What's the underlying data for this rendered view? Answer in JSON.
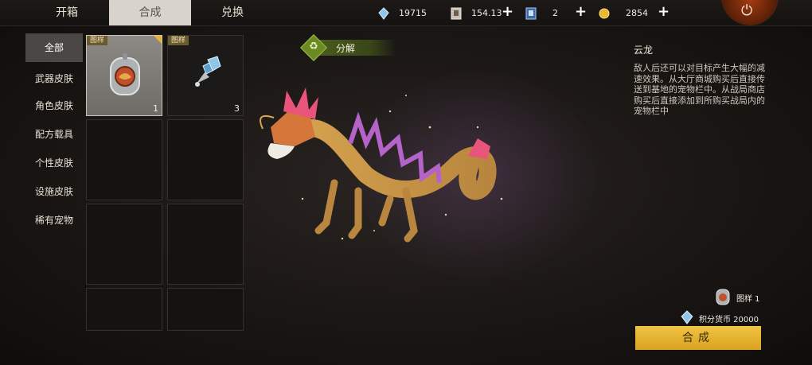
{
  "tabs": [
    {
      "label": "开箱"
    },
    {
      "label": "合成"
    },
    {
      "label": "兑换"
    }
  ],
  "resources": [
    {
      "icon": "crystal-currency-icon",
      "value": "19715"
    },
    {
      "icon": "ticket-card-icon",
      "value": "154.13"
    },
    {
      "icon": "blue-card-icon",
      "value": "2"
    },
    {
      "icon": "gold-coin-icon",
      "value": "2854"
    }
  ],
  "sidebar": {
    "items": [
      {
        "label": "全部"
      },
      {
        "label": "武器皮肤"
      },
      {
        "label": "角色皮肤"
      },
      {
        "label": "配方载具"
      },
      {
        "label": "个性皮肤"
      },
      {
        "label": "设施皮肤"
      },
      {
        "label": "稀有宠物"
      }
    ]
  },
  "inventory": [
    {
      "tag": "图样",
      "count": "1",
      "icon": "pet-badge-icon",
      "selected": true
    },
    {
      "tag": "图样",
      "count": "3",
      "icon": "crystal-rocket-icon",
      "selected": false
    }
  ],
  "decompose": {
    "label": "分解",
    "icon": "recycle-icon"
  },
  "detail": {
    "name": "云龙",
    "description": "敌人后还可以对目标产生大幅的减速效果。从大厅商城购买后直接传送到基地的宠物栏中。从战局商店购买后直接添加到所购买战局内的宠物栏中"
  },
  "requirements": {
    "blueprint": {
      "label": "图样 1",
      "icon": "pet-badge-icon"
    },
    "points": {
      "label": "积分货币 20000",
      "icon": "crystal-currency-icon"
    }
  },
  "craft_button": {
    "label": "合成"
  },
  "power_icon": "power-icon",
  "colors": {
    "accent": "#e8b830",
    "tab_active": "#d8d4cc",
    "decompose": "#6c8a24"
  }
}
